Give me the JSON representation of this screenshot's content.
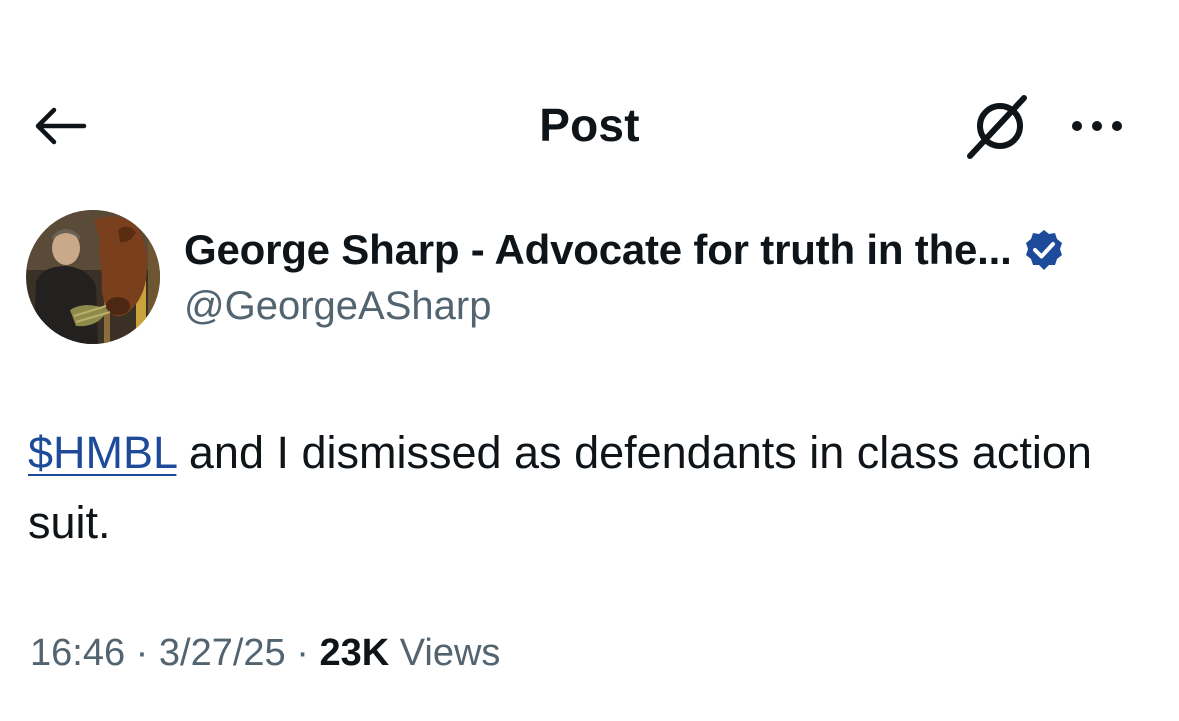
{
  "header": {
    "title": "Post",
    "back_icon": "arrow-left-icon",
    "grok_icon": "grok-icon",
    "more_icon": "more-dots-icon"
  },
  "author": {
    "display_name": "George Sharp - Advocate for truth in the...",
    "handle": "@GeorgeASharp",
    "verified": true,
    "verified_color": "#1d4b9a"
  },
  "post": {
    "cashtag": "$HMBL",
    "text": " and I dismissed as defendants in class action suit."
  },
  "meta": {
    "time": "16:46",
    "separator1": " · ",
    "date": "3/27/25",
    "separator2": " · ",
    "views_count": "23K",
    "views_label": " Views"
  }
}
